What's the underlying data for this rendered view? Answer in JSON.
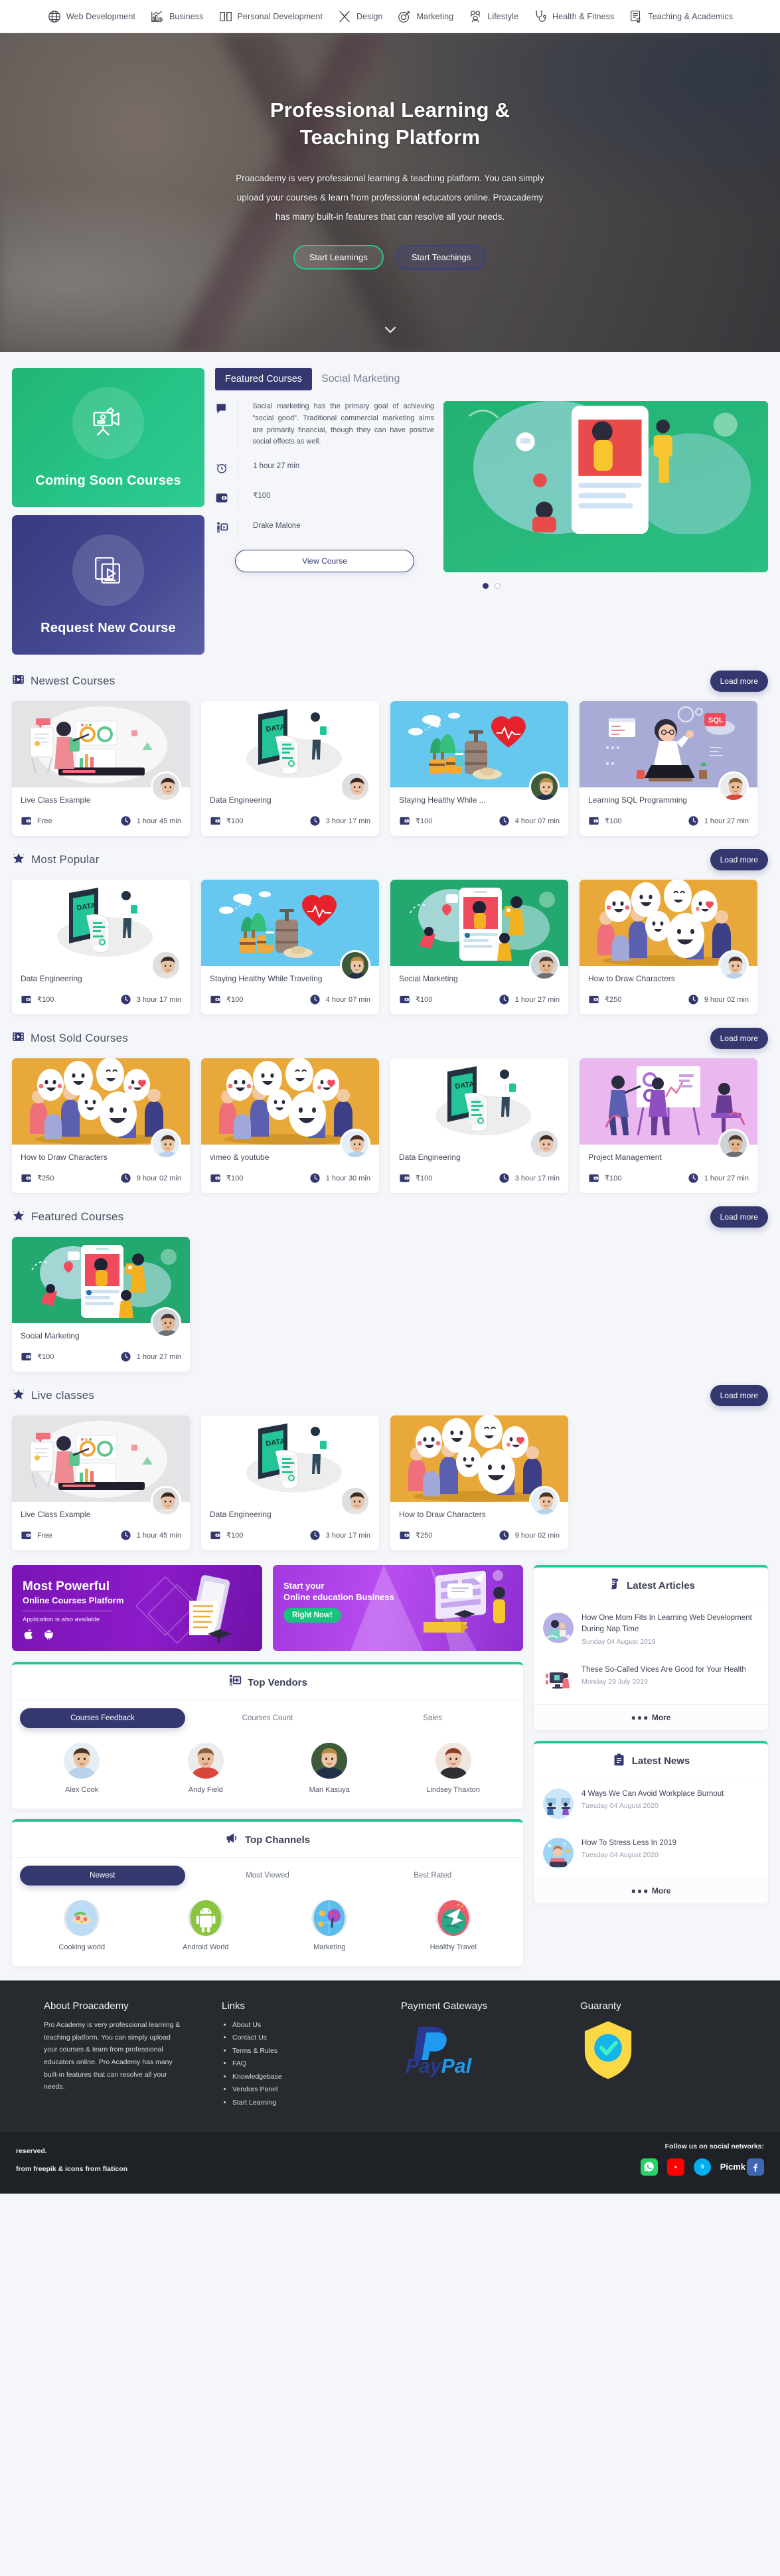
{
  "topnav": {
    "items": [
      {
        "label": "Web Development",
        "icon": "globe-icon"
      },
      {
        "label": "Business",
        "icon": "bar-chart-icon"
      },
      {
        "label": "Personal Development",
        "icon": "book-icon"
      },
      {
        "label": "Design",
        "icon": "brush-icon"
      },
      {
        "label": "Marketing",
        "icon": "target-icon"
      },
      {
        "label": "Lifestyle",
        "icon": "people-icon"
      },
      {
        "label": "Health & Fitness",
        "icon": "stethoscope-icon"
      },
      {
        "label": "Teaching & Academics",
        "icon": "certificate-icon"
      }
    ]
  },
  "hero": {
    "title_line1": "Professional Learning &",
    "title_line2": "Teaching Platform",
    "paragraph": "Proacademy is very professional learning & teaching platform. You can simply upload your courses & learn from professional educators online. Proacademy has many built-in features that can resolve all your needs.",
    "btn_learn": "Start Learnings",
    "btn_teach": "Start Teachings"
  },
  "featured_band": {
    "tile_coming_soon": "Coming Soon Courses",
    "tile_request": "Request New Course",
    "tab_active": "Featured Courses",
    "tab_course_name": "Social Marketing",
    "description": "Social marketing has the primary goal of achieving \"social good\". Traditional commercial marketing aims are primarily financial, though they can have positive social effects as well.",
    "duration": "1 hour 27 min",
    "price": "₹100",
    "author": "Drake Malone",
    "view_course": "View Course"
  },
  "sections": [
    {
      "id": "newest-courses",
      "title": "Newest Courses",
      "icon": "film-icon",
      "load_more": "Load more",
      "cards": [
        {
          "title": "Live Class Example",
          "price": "Free",
          "duration": "1 hour 45 min",
          "media": "live-class-art",
          "bg": "#e4e4e6",
          "avatar": "woman-dark-hair"
        },
        {
          "title": "Data Engineering",
          "price": "₹100",
          "duration": "3 hour 17 min",
          "media": "data-art",
          "bg": "#ffffff",
          "avatar": "woman-dark-hair"
        },
        {
          "title": "Staying Healthy While ...",
          "price": "₹100",
          "duration": "4 hour 07 min",
          "media": "travel-art",
          "bg": "#67c8ef",
          "avatar": "woman-blonde"
        },
        {
          "title": "Learning SQL Programming",
          "price": "₹100",
          "duration": "1 hour 27 min",
          "media": "sql-art",
          "bg": "#a7abd6",
          "avatar": "man-plaid"
        }
      ]
    },
    {
      "id": "most-popular",
      "title": "Most Popular",
      "icon": "star-icon",
      "load_more": "Load more",
      "cards": [
        {
          "title": "Data Engineering",
          "price": "₹100",
          "duration": "3 hour 17 min",
          "media": "data-art",
          "bg": "#ffffff",
          "avatar": "woman-dark-hair"
        },
        {
          "title": "Staying Healthy While Traveling",
          "price": "₹100",
          "duration": "4 hour 07 min",
          "media": "travel-art",
          "bg": "#67c8ef",
          "avatar": "woman-blonde"
        },
        {
          "title": "Social Marketing",
          "price": "₹100",
          "duration": "1 hour 27 min",
          "media": "social-art",
          "bg": "#23a870",
          "avatar": "man-beard"
        },
        {
          "title": "How to Draw Characters",
          "price": "₹250",
          "duration": "9 hour 02 min",
          "media": "characters-art",
          "bg": "#e9a93a",
          "avatar": "man-blue-shirt"
        }
      ]
    },
    {
      "id": "most-sold-courses",
      "title": "Most Sold Courses",
      "icon": "film-icon",
      "load_more": "Load more",
      "cards": [
        {
          "title": "How to Draw Characters",
          "price": "₹250",
          "duration": "9 hour 02 min",
          "media": "characters-art",
          "bg": "#e9a93a",
          "avatar": "man-blue-shirt"
        },
        {
          "title": "vimeo & youtube",
          "price": "₹100",
          "duration": "1 hour 30 min",
          "media": "characters-art",
          "bg": "#e9a93a",
          "avatar": "man-blue-shirt"
        },
        {
          "title": "Data Engineering",
          "price": "₹100",
          "duration": "3 hour 17 min",
          "media": "data-art",
          "bg": "#ffffff",
          "avatar": "woman-dark-hair"
        },
        {
          "title": "Project Management",
          "price": "₹100",
          "duration": "1 hour 27 min",
          "media": "project-art",
          "bg": "#eab7ef",
          "avatar": "man-beard"
        }
      ]
    },
    {
      "id": "featured-courses",
      "title": "Featured Courses",
      "icon": "star-icon",
      "load_more": "Load more",
      "cards": [
        {
          "title": "Social Marketing",
          "price": "₹100",
          "duration": "1 hour 27 min",
          "media": "social-art",
          "bg": "#23a870",
          "avatar": "man-beard"
        }
      ]
    },
    {
      "id": "live-classes",
      "title": "Live classes",
      "icon": "star-icon",
      "load_more": "Load more",
      "cards": [
        {
          "title": "Live Class Example",
          "price": "Free",
          "duration": "1 hour 45 min",
          "media": "live-class-art",
          "bg": "#e4e4e6",
          "avatar": "woman-dark-hair"
        },
        {
          "title": "Data Engineering",
          "price": "₹100",
          "duration": "3 hour 17 min",
          "media": "data-art",
          "bg": "#ffffff",
          "avatar": "woman-dark-hair"
        },
        {
          "title": "How to Draw Characters",
          "price": "₹250",
          "duration": "9 hour 02 min",
          "media": "characters-art",
          "bg": "#e9a93a",
          "avatar": "man-blue-shirt"
        }
      ]
    }
  ],
  "promos": {
    "left": {
      "line1": "Most Powerful",
      "line2": "Online Courses Platform",
      "sub": "Application is also available"
    },
    "right": {
      "line1": "Start your",
      "line2": "Online education Business",
      "badge": "Right Now!"
    }
  },
  "top_vendors": {
    "title": "Top Vendors",
    "icon": "vendor-icon",
    "tabs": [
      "Courses Feedback",
      "Courses Count",
      "Sales"
    ],
    "active_tab": "Courses Feedback",
    "people": [
      {
        "name": "Alex Cook",
        "avatar": "man-blue-shirt"
      },
      {
        "name": "Andy Field",
        "avatar": "man-plaid"
      },
      {
        "name": "Mari Kasuya",
        "avatar": "woman-blonde"
      },
      {
        "name": "Lindsey Thaxton",
        "avatar": "woman-red-hair"
      }
    ]
  },
  "top_channels": {
    "title": "Top Channels",
    "icon": "megaphone-icon",
    "tabs": [
      "Newest",
      "Most Viewed",
      "Best Rated"
    ],
    "active_tab": "Newest",
    "channels": [
      {
        "name": "Cooking world",
        "art": "food-art"
      },
      {
        "name": "Android World",
        "art": "android-art"
      },
      {
        "name": "Marketing",
        "art": "globe-marketing-art"
      },
      {
        "name": "Healthy Travel",
        "art": "travel-globe-art"
      }
    ]
  },
  "latest_articles": {
    "title": "Latest Articles",
    "icon": "scroll-icon",
    "more": "More",
    "items": [
      {
        "title": "How One Mom Fits In Learning Web Development During Nap Time",
        "date": "Sunday 04 August 2019",
        "thumb": "mom-baby-art"
      },
      {
        "title": "These So-Called Vices Are Good for Your Health",
        "date": "Monday 29 July 2019",
        "thumb": "fitness-screen-art"
      }
    ]
  },
  "latest_news": {
    "title": "Latest News",
    "icon": "clipboard-icon",
    "more": "More",
    "items": [
      {
        "title": "4 Ways We Can Avoid Workplace Burnout",
        "date": "Tuesday 04 August 2020",
        "thumb": "office-art"
      },
      {
        "title": "How To Stress Less In 2019",
        "date": "Tuesday 04 August 2020",
        "thumb": "stress-art"
      }
    ]
  },
  "footer": {
    "about_title": "About Proacademy",
    "about_text": "Pro Academy is very professional learning & teaching platform. You can simply upload your courses & learn from professional educators online. Pro Academy has many built-in features that can resolve all your needs.",
    "links_title": "Links",
    "links": [
      "About Us",
      "Contact Us",
      "Terms & Rules",
      "FAQ",
      "Knowledgebase",
      "Vendors Panel",
      "Start Learning"
    ],
    "payment_title": "Payment Gateways",
    "payment_logo": "paypal-logo",
    "guaranty_title": "Guaranty",
    "guaranty_logo": "shield-check-icon",
    "copyright_line1": "reserved.",
    "copyright_line2": "from freepik & icons from flaticon",
    "social_label": "Follow us on social networks:",
    "socials": [
      "whatsapp-icon",
      "youtube-icon",
      "skype-icon",
      "facebook-icon"
    ],
    "watermark": "Picmk"
  }
}
